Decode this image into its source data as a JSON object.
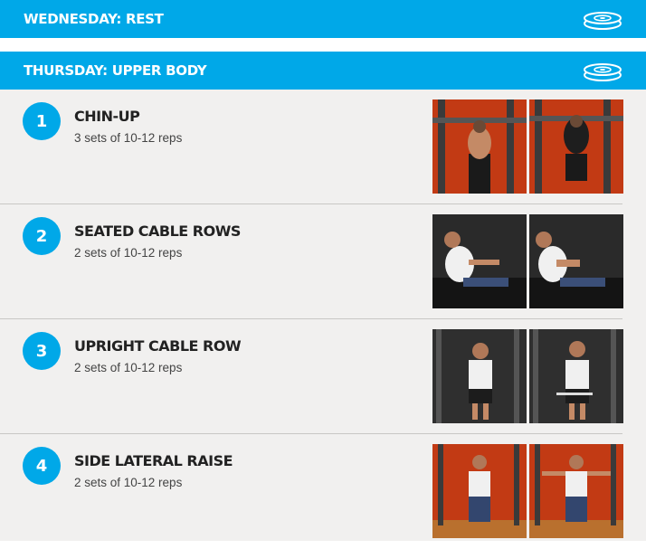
{
  "days": [
    {
      "title": "WEDNESDAY: REST",
      "icon": "weight-plates-icon"
    },
    {
      "title": "THURSDAY: UPPER BODY",
      "icon": "weight-plates-icon"
    }
  ],
  "exercises": [
    {
      "number": "1",
      "name": "CHIN-UP",
      "reps": "3 sets of 10-12 reps"
    },
    {
      "number": "2",
      "name": "SEATED CABLE ROWS",
      "reps": "2 sets of 10-12 reps"
    },
    {
      "number": "3",
      "name": "UPRIGHT CABLE ROW",
      "reps": "2 sets of 10-12 reps"
    },
    {
      "number": "4",
      "name": "SIDE LATERAL RAISE",
      "reps": "2 sets of 10-12 reps"
    }
  ],
  "colors": {
    "accent": "#00a8e8",
    "panel_bg": "#f1f0ef",
    "divider": "#c8c7c5"
  }
}
